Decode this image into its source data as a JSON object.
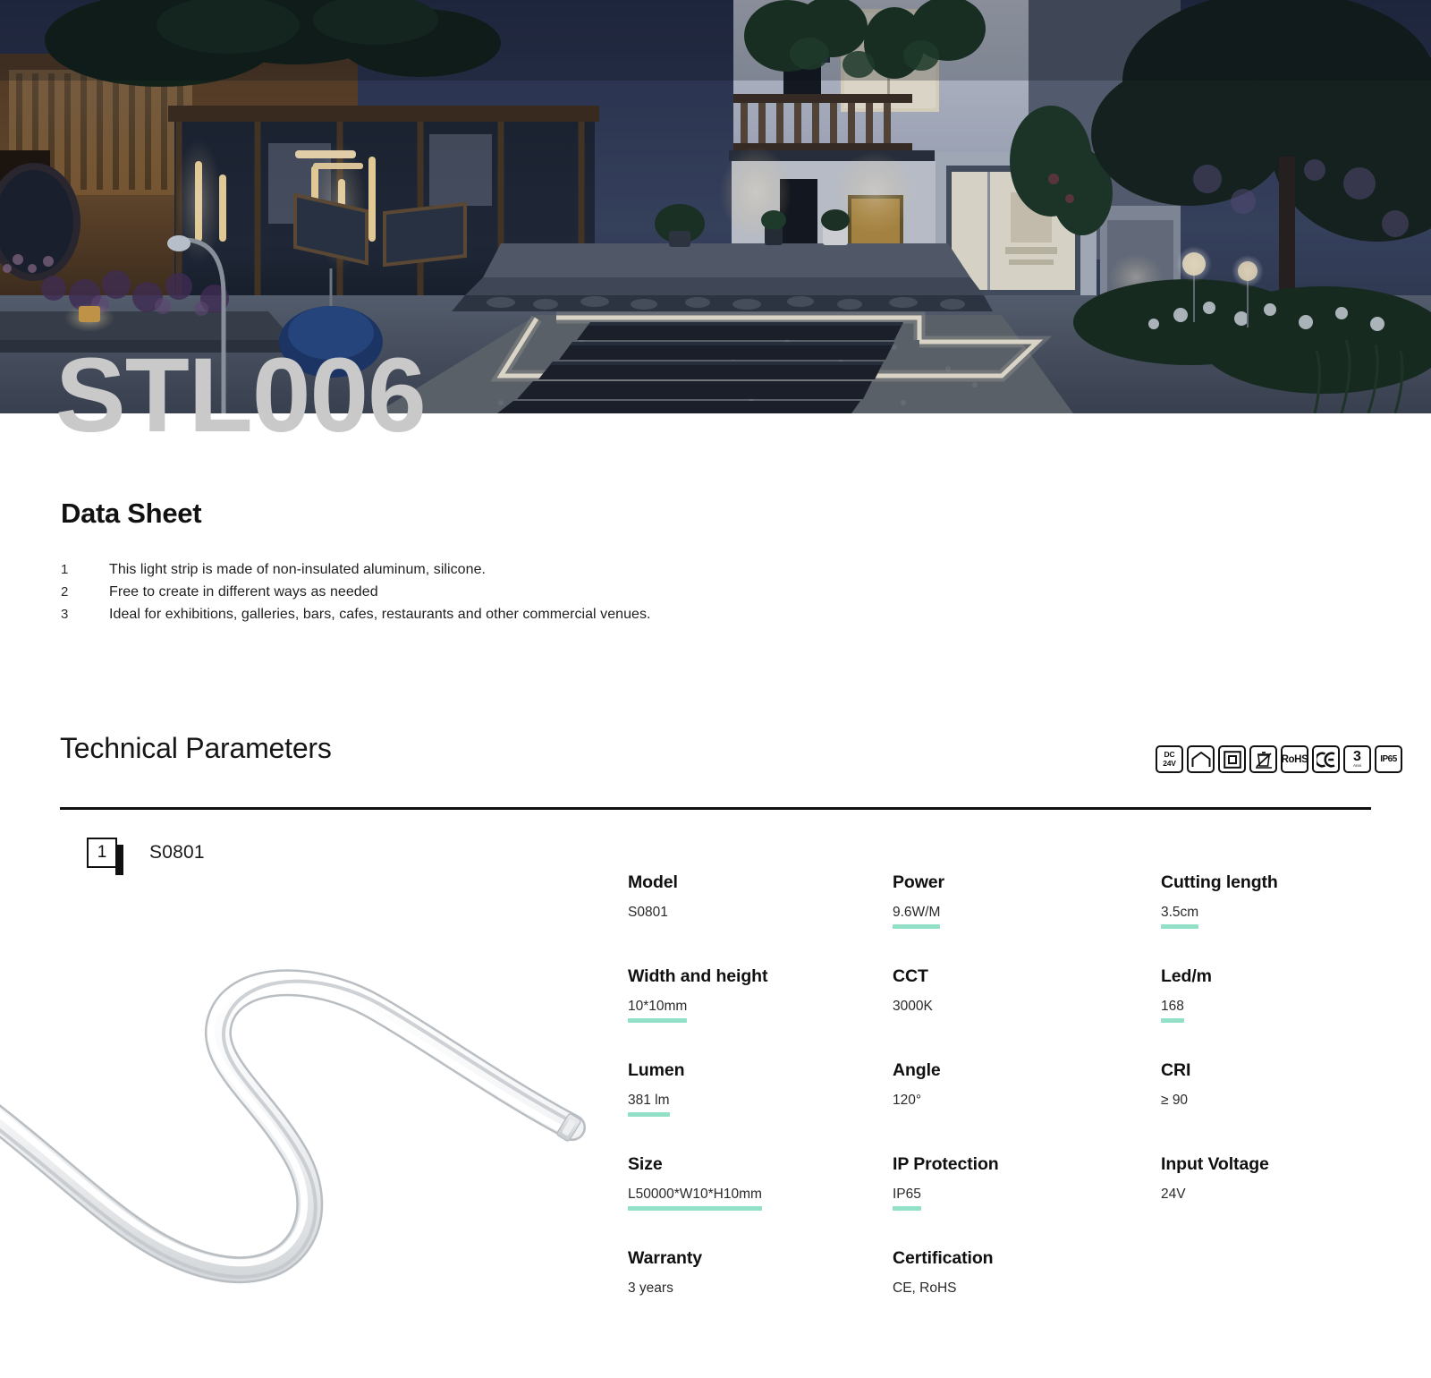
{
  "product": {
    "title": "STL006",
    "hero_alt": "night-garden-led-strip-scene"
  },
  "datasheet": {
    "heading": "Data Sheet",
    "features": [
      {
        "num": "1",
        "text": "This light strip is made of non-insulated aluminum, silicone."
      },
      {
        "num": "2",
        "text": "Free to create in different ways as needed"
      },
      {
        "num": "3",
        "text": "Ideal for exhibitions, galleries, bars, cafes, restaurants and other commercial venues."
      }
    ]
  },
  "technical": {
    "heading": "Technical Parameters",
    "certifications": [
      {
        "id": "dc-voltage",
        "type": "dc",
        "line1": "DC",
        "line2": "24V"
      },
      {
        "id": "indoor-use",
        "type": "house",
        "label": "indoor-use"
      },
      {
        "id": "class-2-insulation",
        "type": "square",
        "label": "class-2"
      },
      {
        "id": "weee-bin",
        "type": "bin",
        "label": "weee"
      },
      {
        "id": "rohs",
        "type": "text",
        "label": "RoHS"
      },
      {
        "id": "ce",
        "type": "ce",
        "label": "CE"
      },
      {
        "id": "warranty-years",
        "type": "years",
        "number": "3",
        "sub": "Anni\nGarantie"
      },
      {
        "id": "ip-rating",
        "type": "ip",
        "label": "IP65"
      }
    ],
    "variant": {
      "badge": "1",
      "name": "S0801"
    },
    "specs": [
      {
        "label": "Model",
        "value": "S0801",
        "underline": false
      },
      {
        "label": "Power",
        "value": "9.6W/M",
        "underline": true
      },
      {
        "label": "Cutting length",
        "value": "3.5cm",
        "underline": true
      },
      {
        "label": "Width and height",
        "value": "10*10mm",
        "underline": true
      },
      {
        "label": "CCT",
        "value": "3000K",
        "underline": false
      },
      {
        "label": "Led/m",
        "value": "168",
        "underline": true
      },
      {
        "label": "Lumen",
        "value": "381 lm",
        "underline": true
      },
      {
        "label": "Angle",
        "value": "120°",
        "underline": false
      },
      {
        "label": "CRI",
        "value": "≥ 90",
        "underline": false
      },
      {
        "label": "Size",
        "value": "L50000*W10*H10mm",
        "underline": true
      },
      {
        "label": "IP Protection",
        "value": "IP65",
        "underline": true
      },
      {
        "label": "Input Voltage",
        "value": "24V",
        "underline": false
      },
      {
        "label": "Warranty",
        "value": "3 years",
        "underline": false
      },
      {
        "label": "Certification",
        "value": "CE, RoHS",
        "underline": false
      }
    ]
  },
  "colors": {
    "accent_underline": "#93e0c9",
    "title_gray": "#c9c9c9",
    "text_dark": "#111111"
  }
}
